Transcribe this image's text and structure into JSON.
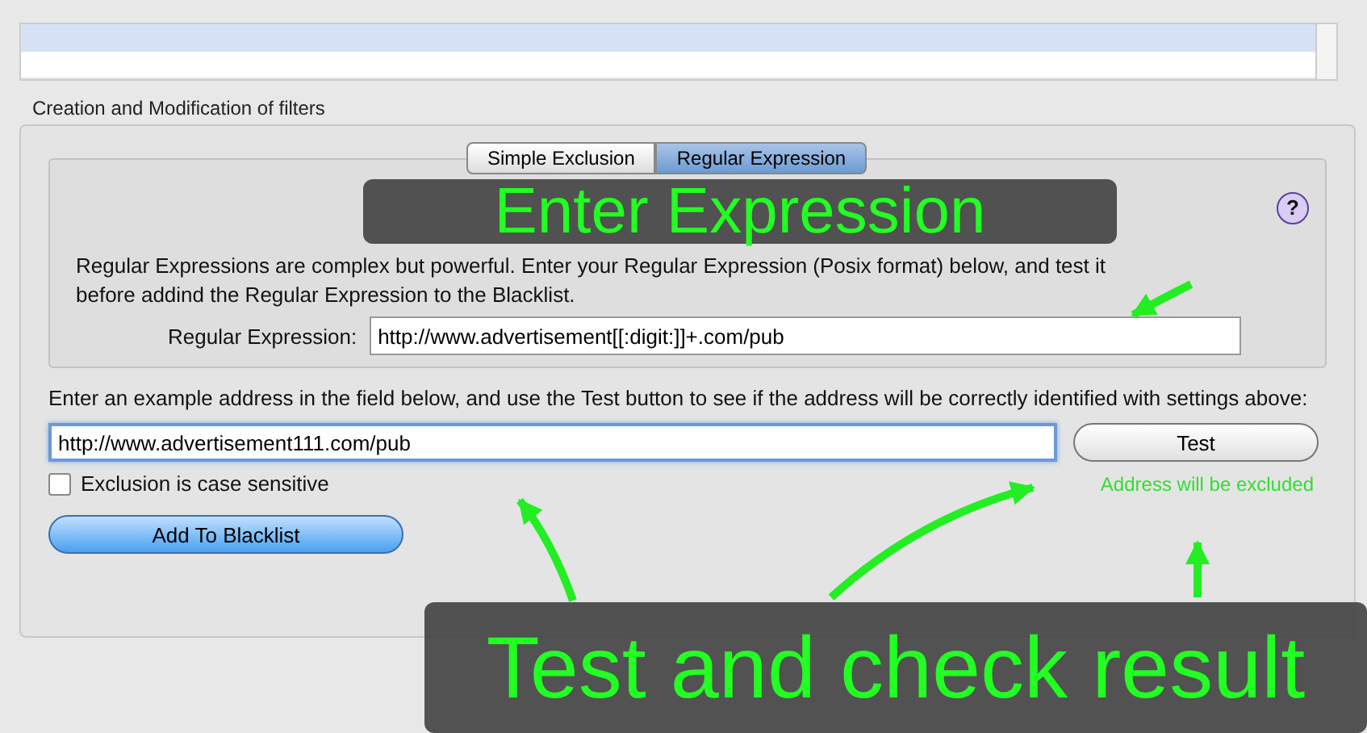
{
  "filter_list": {
    "rows": [
      {
        "selected": true
      },
      {
        "selected": false
      }
    ]
  },
  "section_title": "Creation and Modification of filters",
  "tabs": [
    {
      "label": "Simple Exclusion",
      "selected": false
    },
    {
      "label": "Regular Expression",
      "selected": true
    }
  ],
  "help_button": "?",
  "description": "Regular Expressions are complex but powerful. Enter your Regular Expression (Posix format) below, and test it before addind the Regular Expression to the Blacklist.",
  "regex_field": {
    "label": "Regular Expression:",
    "value": "http://www.advertisement[[:digit:]]+.com/pub"
  },
  "test_instructions": "Enter an example address in the field below, and use the Test button to see if the address will be correctly identified with settings above:",
  "test_field": {
    "value": "http://www.advertisement111.com/pub",
    "focused": true
  },
  "test_button": "Test",
  "case_sensitive": {
    "label": "Exclusion is case sensitive",
    "checked": false
  },
  "test_result": {
    "text": "Address will be excluded",
    "color": "#33dd33"
  },
  "add_button": "Add To Blacklist",
  "annotations": [
    {
      "text": "Enter Expression"
    },
    {
      "text": "Test and check result"
    }
  ]
}
